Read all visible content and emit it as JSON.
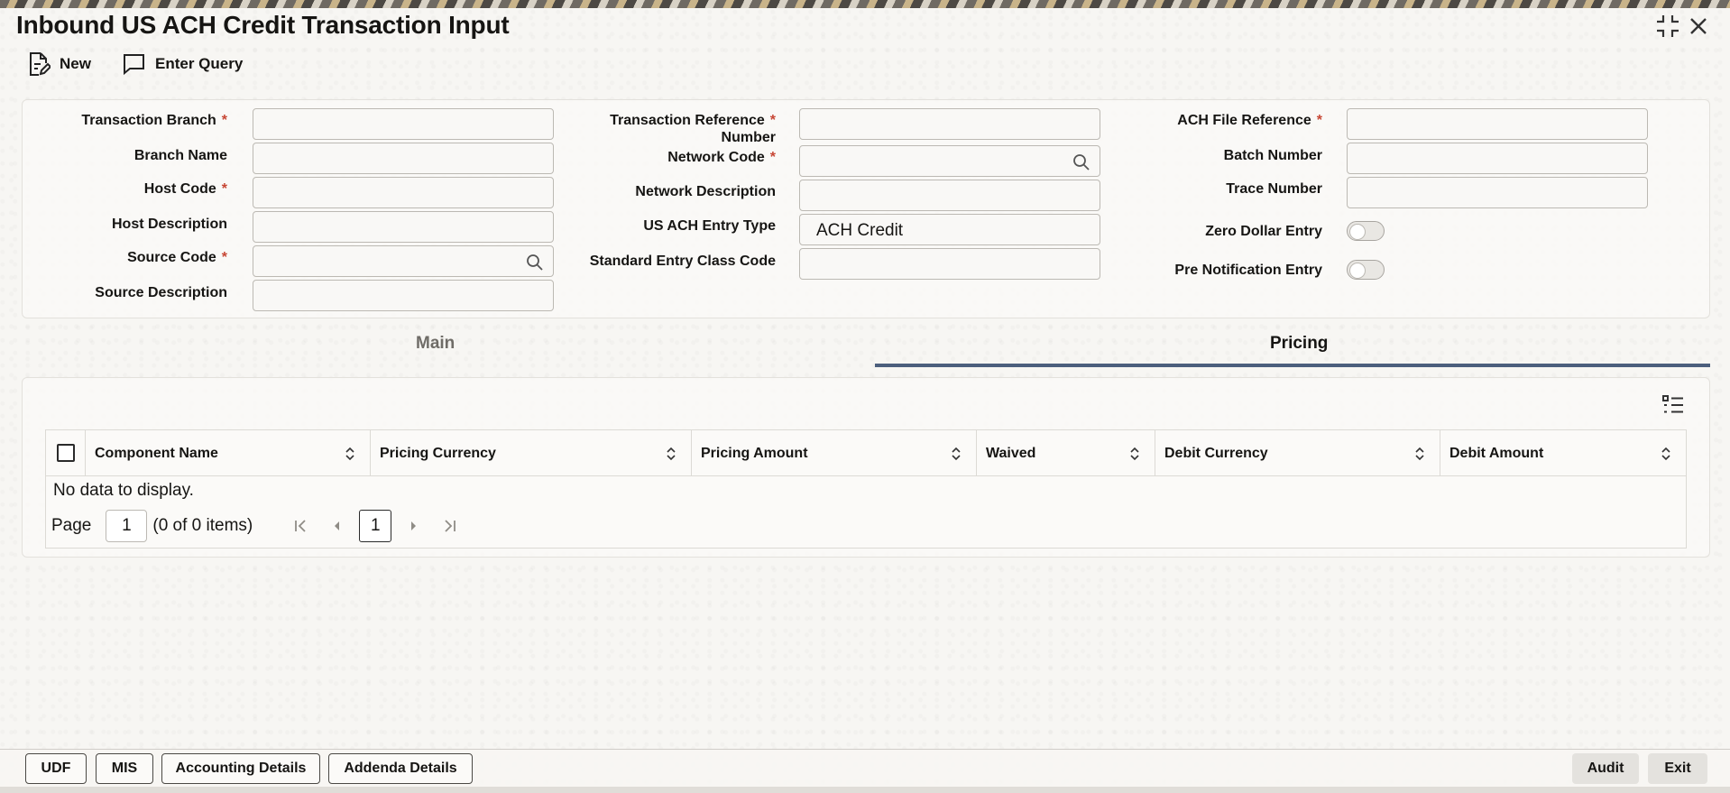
{
  "window": {
    "title": "Inbound US ACH Credit Transaction Input"
  },
  "toolbar": {
    "new_label": "New",
    "enter_query_label": "Enter Query"
  },
  "form": {
    "transaction_branch": {
      "label": "Transaction Branch",
      "required": "*",
      "value": ""
    },
    "branch_name": {
      "label": "Branch Name",
      "value": ""
    },
    "host_code": {
      "label": "Host Code",
      "required": "*",
      "value": ""
    },
    "host_description": {
      "label": "Host Description",
      "value": ""
    },
    "source_code": {
      "label": "Source Code",
      "required": "*",
      "value": ""
    },
    "source_description": {
      "label": "Source Description",
      "value": ""
    },
    "transaction_reference_number": {
      "label_line1": "Transaction Reference",
      "label_line2": "Number",
      "required": "*",
      "value": ""
    },
    "network_code": {
      "label": "Network Code",
      "required": "*",
      "value": ""
    },
    "network_description": {
      "label": "Network Description",
      "value": ""
    },
    "us_ach_entry_type": {
      "label": "US ACH Entry Type",
      "value": "ACH Credit"
    },
    "standard_entry_class_code": {
      "label": "Standard Entry Class Code",
      "value": ""
    },
    "ach_file_reference": {
      "label": "ACH File Reference",
      "required": "*",
      "value": ""
    },
    "batch_number": {
      "label": "Batch Number",
      "value": ""
    },
    "trace_number": {
      "label": "Trace Number",
      "value": ""
    },
    "zero_dollar_entry": {
      "label": "Zero Dollar Entry",
      "checked": false
    },
    "pre_notification_entry": {
      "label": "Pre Notification Entry",
      "checked": false
    }
  },
  "tabs": [
    {
      "label": "Main",
      "active": false
    },
    {
      "label": "Pricing",
      "active": true
    }
  ],
  "pricing_table": {
    "columns": [
      "Component Name",
      "Pricing Currency",
      "Pricing Amount",
      "Waived",
      "Debit Currency",
      "Debit Amount"
    ],
    "rows": [],
    "empty_text": "No data to display.",
    "pager": {
      "page_label": "Page",
      "page_value": "1",
      "count_text": "(0 of 0 items)",
      "current_page": "1"
    }
  },
  "footer": {
    "udf": "UDF",
    "mis": "MIS",
    "accounting_details": "Accounting Details",
    "addenda_details": "Addenda Details",
    "audit": "Audit",
    "exit": "Exit"
  },
  "colors": {
    "accent_tab": "#4c5f7d",
    "required": "#c74634"
  }
}
